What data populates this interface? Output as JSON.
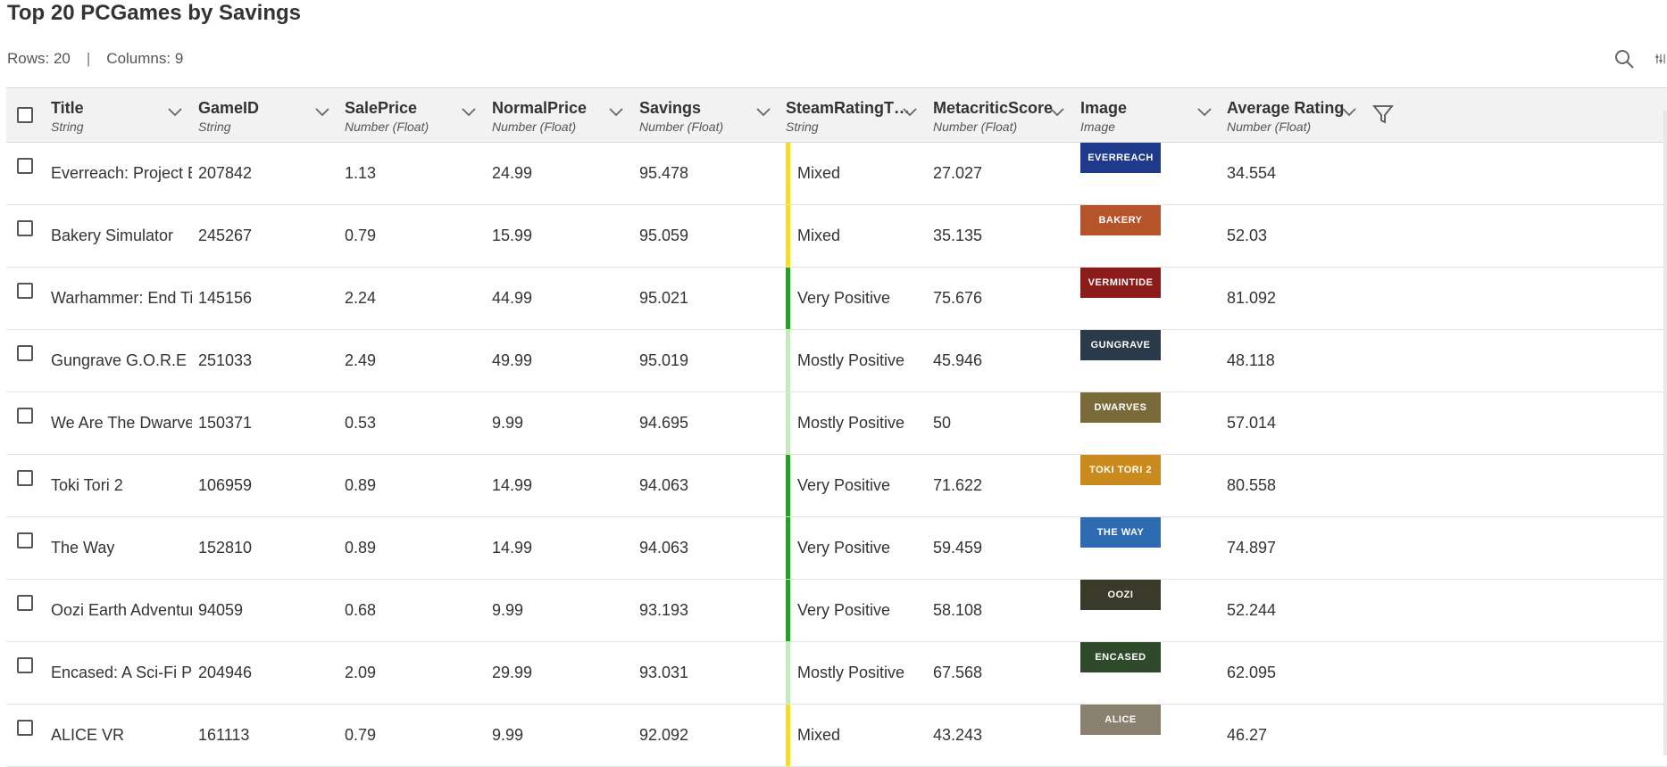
{
  "page_title": "Top 20 PCGames by Savings",
  "rows_info": "Rows: 20",
  "separator": "|",
  "cols_info": "Columns: 9",
  "columns": [
    {
      "name": "Title",
      "type": "String"
    },
    {
      "name": "GameID",
      "type": "String"
    },
    {
      "name": "SalePrice",
      "type": "Number (Float)"
    },
    {
      "name": "NormalPrice",
      "type": "Number (Float)"
    },
    {
      "name": "Savings",
      "type": "Number (Float)"
    },
    {
      "name": "SteamRatingT…",
      "type": "String"
    },
    {
      "name": "MetacriticScore",
      "type": "Number (Float)"
    },
    {
      "name": "Image",
      "type": "Image"
    },
    {
      "name": "Average Rating",
      "type": "Number (Float)"
    }
  ],
  "rating_colors": {
    "Mixed": "#f0dc3c",
    "Very Positive": "#2e9a2e",
    "Mostly Positive": "#c8e6c0"
  },
  "rows": [
    {
      "title": "Everreach: Project Ec",
      "gameid": "207842",
      "sale": "1.13",
      "normal": "24.99",
      "savings": "95.478",
      "rating": "Mixed",
      "meta": "27.027",
      "thumb_text": "EVERREACH",
      "thumb_color": "#1f3a8a",
      "avg": "34.554"
    },
    {
      "title": "Bakery Simulator",
      "gameid": "245267",
      "sale": "0.79",
      "normal": "15.99",
      "savings": "95.059",
      "rating": "Mixed",
      "meta": "35.135",
      "thumb_text": "BAKERY",
      "thumb_color": "#b5532a",
      "avg": "52.03"
    },
    {
      "title": "Warhammer: End Tin",
      "gameid": "145156",
      "sale": "2.24",
      "normal": "44.99",
      "savings": "95.021",
      "rating": "Very Positive",
      "meta": "75.676",
      "thumb_text": "VERMINTIDE",
      "thumb_color": "#8a1c1c",
      "avg": "81.092"
    },
    {
      "title": "Gungrave G.O.R.E",
      "gameid": "251033",
      "sale": "2.49",
      "normal": "49.99",
      "savings": "95.019",
      "rating": "Mostly Positive",
      "meta": "45.946",
      "thumb_text": "GUNGRAVE",
      "thumb_color": "#2b3a4a",
      "avg": "48.118"
    },
    {
      "title": "We Are The Dwarves",
      "gameid": "150371",
      "sale": "0.53",
      "normal": "9.99",
      "savings": "94.695",
      "rating": "Mostly Positive",
      "meta": "50",
      "thumb_text": "DWARVES",
      "thumb_color": "#7a6a3a",
      "avg": "57.014"
    },
    {
      "title": "Toki Tori 2",
      "gameid": "106959",
      "sale": "0.89",
      "normal": "14.99",
      "savings": "94.063",
      "rating": "Very Positive",
      "meta": "71.622",
      "thumb_text": "TOKI TORI 2",
      "thumb_color": "#c98a1e",
      "avg": "80.558"
    },
    {
      "title": "The Way",
      "gameid": "152810",
      "sale": "0.89",
      "normal": "14.99",
      "savings": "94.063",
      "rating": "Very Positive",
      "meta": "59.459",
      "thumb_text": "THE WAY",
      "thumb_color": "#2f6bb0",
      "avg": "74.897"
    },
    {
      "title": "Oozi Earth Adventure",
      "gameid": "94059",
      "sale": "0.68",
      "normal": "9.99",
      "savings": "93.193",
      "rating": "Very Positive",
      "meta": "58.108",
      "thumb_text": "OOZI",
      "thumb_color": "#3a3a2a",
      "avg": "52.244"
    },
    {
      "title": "Encased: A Sci-Fi Po",
      "gameid": "204946",
      "sale": "2.09",
      "normal": "29.99",
      "savings": "93.031",
      "rating": "Mostly Positive",
      "meta": "67.568",
      "thumb_text": "ENCASED",
      "thumb_color": "#2f4a2a",
      "avg": "62.095"
    },
    {
      "title": "ALICE VR",
      "gameid": "161113",
      "sale": "0.79",
      "normal": "9.99",
      "savings": "92.092",
      "rating": "Mixed",
      "meta": "43.243",
      "thumb_text": "ALICE",
      "thumb_color": "#8a8070",
      "avg": "46.27"
    }
  ]
}
